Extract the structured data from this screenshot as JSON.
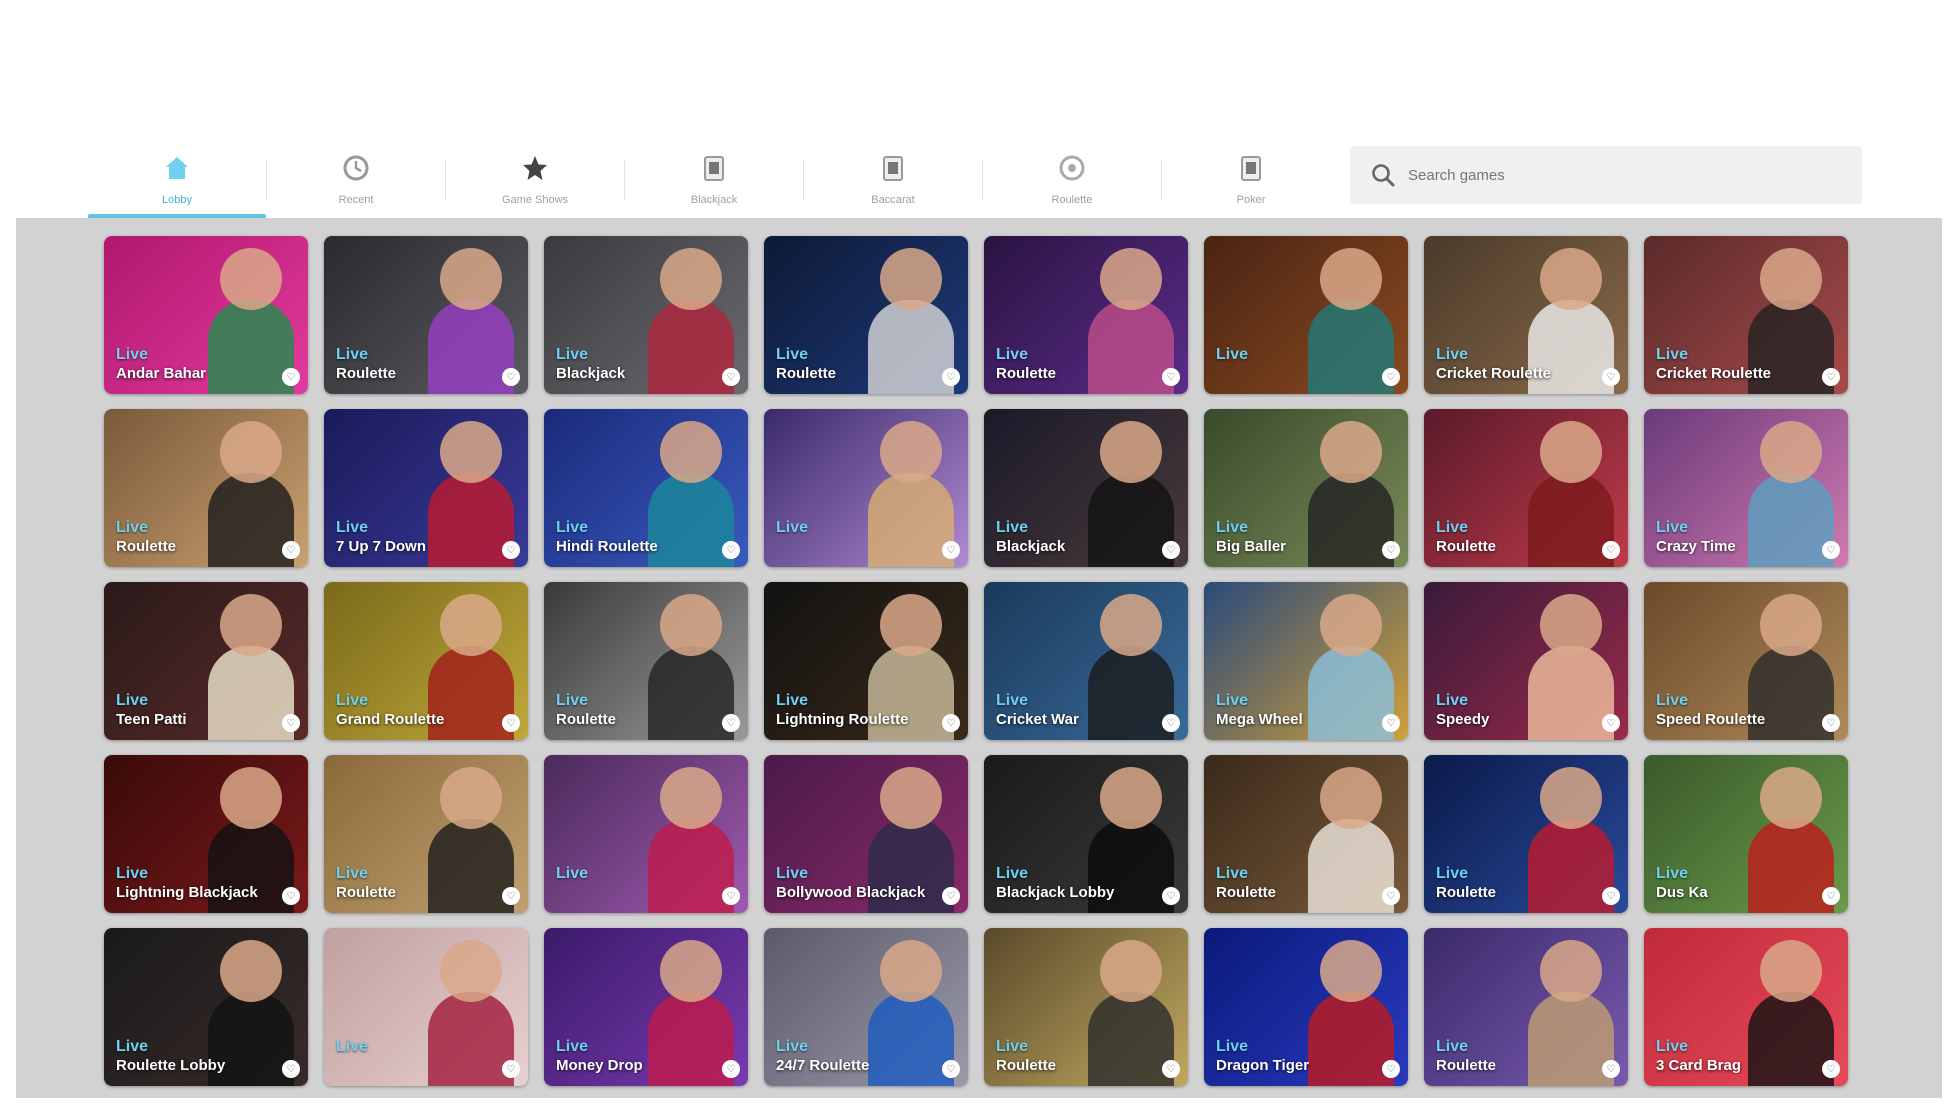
{
  "tabs": [
    {
      "label": "Lobby",
      "icon": "home-icon",
      "active": true
    },
    {
      "label": "Recent",
      "icon": "clock-icon",
      "active": false
    },
    {
      "label": "Game Shows",
      "icon": "star-icon",
      "active": false
    },
    {
      "label": "Blackjack",
      "icon": "cards-icon",
      "active": false
    },
    {
      "label": "Baccarat",
      "icon": "cards-icon",
      "active": false
    },
    {
      "label": "Roulette",
      "icon": "roulette-icon",
      "active": false
    },
    {
      "label": "Poker",
      "icon": "cards-icon",
      "active": false
    }
  ],
  "search": {
    "placeholder": "Search games"
  },
  "accent_color": "#62c4e6",
  "cards": [
    {
      "live": "Live",
      "title": "Andar Bahar",
      "badge": "",
      "provider": "",
      "colors": [
        "#b0186e",
        "#e33a9d",
        "#1e8f4a"
      ]
    },
    {
      "live": "Live",
      "title": "Roulette",
      "badge": "",
      "provider": "",
      "colors": [
        "#2a2a2e",
        "#5a5a60",
        "#9a3fc7"
      ]
    },
    {
      "live": "Live",
      "title": "Blackjack",
      "badge": "",
      "provider": "",
      "colors": [
        "#3a3a3e",
        "#6a6a70",
        "#b0243c"
      ]
    },
    {
      "live": "Live",
      "title": "Roulette",
      "badge": "",
      "provider": "",
      "colors": [
        "#0d1a36",
        "#1f3a7a",
        "#d9d9d9"
      ]
    },
    {
      "live": "Live",
      "title": "Roulette",
      "badge": "",
      "provider": "",
      "colors": [
        "#2a1442",
        "#5b2c8a",
        "#c04d8a"
      ]
    },
    {
      "live": "Live",
      "title": "",
      "badge": "",
      "provider": "",
      "colors": [
        "#4a2412",
        "#8a4a22",
        "#1f7a7a"
      ]
    },
    {
      "live": "Live",
      "title": "Cricket Roulette",
      "badge": "",
      "provider": "",
      "colors": [
        "#4a3a2a",
        "#8a6a4a",
        "#f0f0f0"
      ]
    },
    {
      "live": "Live",
      "title": "Cricket Roulette",
      "badge": "",
      "provider": "",
      "colors": [
        "#5a2a2a",
        "#a84a4a",
        "#222222"
      ]
    },
    {
      "live": "Live",
      "title": "Roulette",
      "badge": "",
      "provider": "",
      "colors": [
        "#7a5a3a",
        "#c9a070",
        "#1a1a1a"
      ]
    },
    {
      "live": "Live",
      "title": "7 Up 7 Down",
      "badge": "",
      "provider": "",
      "colors": [
        "#1a1a5a",
        "#3a3a9a",
        "#c01a2a"
      ]
    },
    {
      "live": "Live",
      "title": "Hindi Roulette",
      "badge": "",
      "provider": "",
      "colors": [
        "#1a2a7a",
        "#3a5ac0",
        "#1a8a9a"
      ]
    },
    {
      "live": "Live",
      "title": "",
      "badge": "",
      "provider": "",
      "colors": [
        "#3a2a6a",
        "#b08ad0",
        "#d9b070"
      ]
    },
    {
      "live": "Live",
      "title": "Blackjack",
      "badge": "",
      "provider": "",
      "colors": [
        "#1a1a2a",
        "#4a3a3a",
        "#111111"
      ]
    },
    {
      "live": "Live",
      "title": "Big Baller",
      "badge": "",
      "provider": "",
      "colors": [
        "#3a4a2a",
        "#7a8a5a",
        "#222222"
      ]
    },
    {
      "live": "Live",
      "title": "Roulette",
      "badge": "",
      "provider": "",
      "colors": [
        "#5a1a2a",
        "#c03a4a",
        "#7a1a1a"
      ]
    },
    {
      "live": "Live",
      "title": "Crazy Time",
      "badge": "",
      "provider": "",
      "colors": [
        "#6a3a7a",
        "#d07ab0",
        "#5aa0c0"
      ]
    },
    {
      "live": "Live",
      "title": "Teen Patti",
      "badge": "",
      "provider": "",
      "colors": [
        "#2a1a1a",
        "#5a2a2a",
        "#f0e8d0"
      ]
    },
    {
      "live": "Live",
      "title": "Grand Roulette",
      "badge": "",
      "provider": "",
      "colors": [
        "#7a6a1a",
        "#c0a83a",
        "#a01a1a"
      ]
    },
    {
      "live": "Live",
      "title": "Roulette",
      "badge": "",
      "provider": "",
      "colors": [
        "#3a3a3a",
        "#9a9a9a",
        "#222222"
      ]
    },
    {
      "live": "Live",
      "title": "Lightning Roulette",
      "badge": "",
      "provider": "",
      "colors": [
        "#111111",
        "#3a2a1a",
        "#d0c0a0"
      ]
    },
    {
      "live": "Live",
      "title": "Cricket War",
      "badge": "",
      "provider": "",
      "colors": [
        "#1a3a5a",
        "#3a6a9a",
        "#1a1a1a"
      ]
    },
    {
      "live": "Live",
      "title": "Mega Wheel",
      "badge": "",
      "provider": "",
      "colors": [
        "#2a4a7a",
        "#d0a03a",
        "#8ac0e0"
      ]
    },
    {
      "live": "Live",
      "title": "Speedy",
      "badge": "",
      "provider": "",
      "colors": [
        "#3a1a3a",
        "#9a2a4a",
        "#f0c0a0"
      ]
    },
    {
      "live": "Live",
      "title": "Speed Roulette",
      "badge": "",
      "provider": "",
      "colors": [
        "#6a4a2a",
        "#b08a5a",
        "#2a2a2a"
      ]
    },
    {
      "live": "Live",
      "title": "Lightning Blackjack",
      "badge": "",
      "provider": "",
      "colors": [
        "#3a0a0a",
        "#7a1a1a",
        "#111111"
      ]
    },
    {
      "live": "Live",
      "title": "Roulette",
      "badge": "",
      "provider": "",
      "colors": [
        "#8a6a3a",
        "#c0a070",
        "#1a1a1a"
      ]
    },
    {
      "live": "Live",
      "title": "",
      "badge": "",
      "provider": "",
      "colors": [
        "#4a2a5a",
        "#a05ab0",
        "#c01a4a"
      ]
    },
    {
      "live": "Live",
      "title": "Bollywood Blackjack",
      "badge": "",
      "provider": "",
      "colors": [
        "#4a1a4a",
        "#8a2a6a",
        "#2a2a4a"
      ]
    },
    {
      "live": "Live",
      "title": "Blackjack Lobby",
      "badge": "",
      "provider": "",
      "colors": [
        "#1a1a1a",
        "#3a3a3a",
        "#0a0a0a"
      ]
    },
    {
      "live": "Live",
      "title": "Roulette",
      "badge": "",
      "provider": "",
      "colors": [
        "#3a2a1a",
        "#7a5a3a",
        "#f0e8e0"
      ]
    },
    {
      "live": "Live",
      "title": "Roulette",
      "badge": "",
      "provider": "",
      "colors": [
        "#0a1a4a",
        "#2a4a9a",
        "#c01a2a"
      ]
    },
    {
      "live": "Live",
      "title": "Dus Ka",
      "badge": "",
      "provider": "",
      "colors": [
        "#3a5a2a",
        "#6a9a4a",
        "#c01a1a"
      ]
    },
    {
      "live": "Live",
      "title": "Roulette Lobby",
      "badge": "",
      "provider": "",
      "colors": [
        "#1a1a1a",
        "#3a2a2a",
        "#111111"
      ]
    },
    {
      "live": "Live",
      "title": "",
      "badge": "",
      "provider": "",
      "colors": [
        "#c0a0a0",
        "#e8d0d0",
        "#a01a3a"
      ]
    },
    {
      "live": "Live",
      "title": "Money Drop",
      "badge": "",
      "provider": "",
      "colors": [
        "#3a1a6a",
        "#7a3ab0",
        "#c01a4a"
      ]
    },
    {
      "live": "Live",
      "title": "24/7 Roulette",
      "badge": "",
      "provider": "",
      "colors": [
        "#5a5a6a",
        "#9a9aaa",
        "#1a5ac0"
      ]
    },
    {
      "live": "Live",
      "title": "Roulette",
      "badge": "",
      "provider": "",
      "colors": [
        "#5a4a2a",
        "#c0a860",
        "#2a2a2a"
      ]
    },
    {
      "live": "Live",
      "title": "Dragon Tiger",
      "badge": "",
      "provider": "",
      "colors": [
        "#0a1a7a",
        "#2a3ac0",
        "#c01a1a"
      ]
    },
    {
      "live": "Live",
      "title": "Roulette",
      "badge": "",
      "provider": "",
      "colors": [
        "#3a2a6a",
        "#7a5ab0",
        "#c0a070"
      ]
    },
    {
      "live": "Live",
      "title": "3 Card Brag",
      "badge": "",
      "provider": "",
      "colors": [
        "#c02a3a",
        "#e84a5a",
        "#111111"
      ]
    }
  ]
}
